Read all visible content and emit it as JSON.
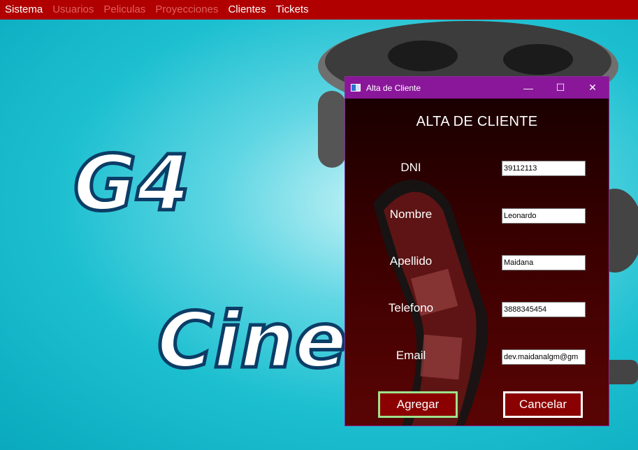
{
  "menubar": {
    "items": [
      {
        "label": "Sistema",
        "enabled": true
      },
      {
        "label": "Usuarios",
        "enabled": false
      },
      {
        "label": "Peliculas",
        "enabled": false
      },
      {
        "label": "Proyecciones",
        "enabled": false
      },
      {
        "label": "Clientes",
        "enabled": true
      },
      {
        "label": "Tickets",
        "enabled": true
      }
    ]
  },
  "background": {
    "logo_text_1": "G4",
    "logo_text_2": "Cine"
  },
  "dialog": {
    "title": "Alta de Cliente",
    "heading": "ALTA DE CLIENTE",
    "fields": {
      "dni": {
        "label": "DNI",
        "value": "39112113"
      },
      "nombre": {
        "label": "Nombre",
        "value": "Leonardo"
      },
      "apellido": {
        "label": "Apellido",
        "value": "Maidana"
      },
      "telefono": {
        "label": "Telefono",
        "value": "3888345454"
      },
      "email": {
        "label": "Email",
        "value": "dev.maidanalgm@gm"
      }
    },
    "buttons": {
      "add": "Agregar",
      "cancel": "Cancelar"
    },
    "window_controls": {
      "minimize": "—",
      "maximize": "☐",
      "close": "✕"
    }
  },
  "colors": {
    "menubar": "#b00000",
    "titlebar": "#8a179a",
    "dialog_bg": "#2a0000",
    "button_bg": "#8b0000",
    "add_border": "#9ee28a",
    "cancel_border": "#ffffff"
  }
}
